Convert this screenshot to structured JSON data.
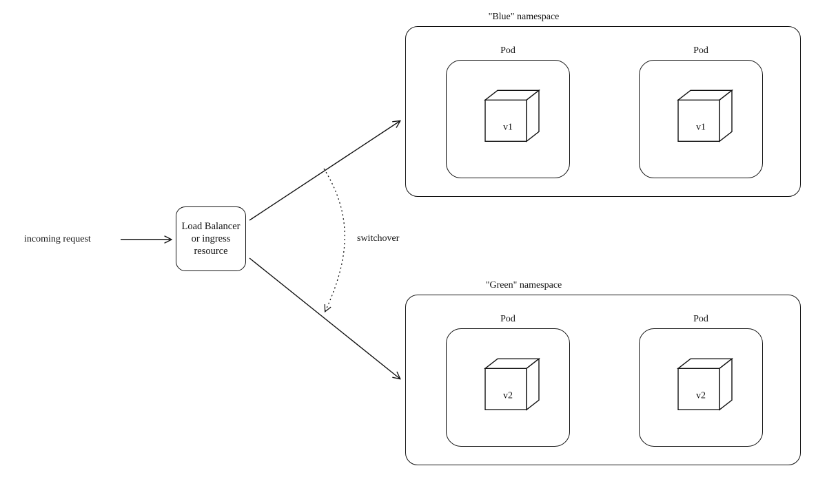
{
  "labels": {
    "incoming_request": "incoming request",
    "load_balancer": "Load\nBalancer or\ningress\nresource",
    "switchover": "switchover",
    "blue_ns": "\"Blue\" namespace",
    "green_ns": "\"Green\" namespace",
    "pod": "Pod"
  },
  "versions": {
    "blue": "v1",
    "green": "v2"
  },
  "diagram": {
    "type": "blue-green-deployment",
    "description": "Incoming request goes to a Load Balancer / ingress resource which routes either to the Blue namespace (pods running v1) or, after switchover, to the Green namespace (pods running v2).",
    "nodes": [
      {
        "id": "incoming",
        "kind": "source",
        "label_key": "labels.incoming_request"
      },
      {
        "id": "lb",
        "kind": "router",
        "label_key": "labels.load_balancer"
      },
      {
        "id": "blue-ns",
        "kind": "namespace",
        "label_key": "labels.blue_ns",
        "pods": [
          {
            "id": "blue-pod-1",
            "version_key": "versions.blue"
          },
          {
            "id": "blue-pod-2",
            "version_key": "versions.blue"
          }
        ]
      },
      {
        "id": "green-ns",
        "kind": "namespace",
        "label_key": "labels.green_ns",
        "pods": [
          {
            "id": "green-pod-1",
            "version_key": "versions.green"
          },
          {
            "id": "green-pod-2",
            "version_key": "versions.green"
          }
        ]
      }
    ],
    "edges": [
      {
        "from": "incoming",
        "to": "lb",
        "style": "solid"
      },
      {
        "from": "lb",
        "to": "blue-ns",
        "style": "solid"
      },
      {
        "from": "lb",
        "to": "green-ns",
        "style": "solid"
      },
      {
        "from": "blue-edge",
        "to": "green-edge",
        "style": "dotted",
        "label_key": "labels.switchover"
      }
    ]
  }
}
